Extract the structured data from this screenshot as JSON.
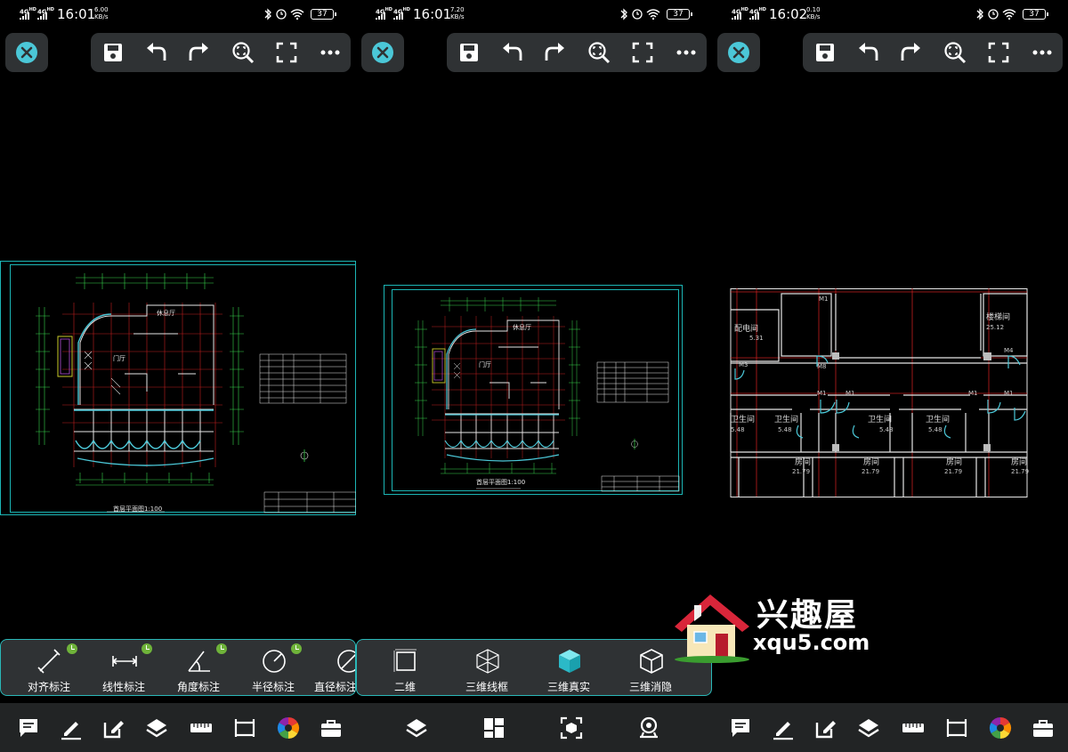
{
  "colors": {
    "accent": "#4bc7d7",
    "panel": "#2f3234",
    "cad_frame": "#1cb6b6",
    "cad_red": "#c21e1e",
    "cad_green": "#38d34c",
    "cad_white": "#e6e6e6",
    "badge_green": "#6fb33a"
  },
  "screens": [
    {
      "status": {
        "sig1": "4G",
        "sig1_sup": "HD",
        "sig2": "4G",
        "sig2_sup": "HD",
        "time": "16:01",
        "speed_value": "6.00",
        "speed_unit": "KB/s",
        "battery": "37"
      },
      "sub_panel": [
        {
          "label": "对齐标注",
          "icon": "aligned-dimension-icon"
        },
        {
          "label": "线性标注",
          "icon": "linear-dimension-icon"
        },
        {
          "label": "角度标注",
          "icon": "angle-dimension-icon"
        },
        {
          "label": "半径标注",
          "icon": "radius-dimension-icon"
        },
        {
          "label": "直径标注",
          "icon": "diameter-dimension-icon"
        }
      ],
      "drawing_title": "首层平面图1:100",
      "room_hall": "门厅",
      "room_lounge": "休息厅"
    },
    {
      "status": {
        "sig1": "4G",
        "sig1_sup": "HD",
        "sig2": "4G",
        "sig2_sup": "HD",
        "time": "16:01",
        "speed_value": "7.20",
        "speed_unit": "KB/s",
        "battery": "37"
      },
      "sub_panel": [
        {
          "label": "二维",
          "icon": "2d-square-icon"
        },
        {
          "label": "三维线框",
          "icon": "3d-wireframe-icon"
        },
        {
          "label": "三维真实",
          "icon": "3d-realistic-icon"
        },
        {
          "label": "三维消隐",
          "icon": "3d-hidden-icon"
        }
      ],
      "drawing_title": "首层平面图1:100",
      "room_hall": "门厅",
      "room_lounge": "休息厅"
    },
    {
      "status": {
        "sig1": "4G",
        "sig1_sup": "HD",
        "sig2": "4G",
        "sig2_sup": "HD",
        "time": "16:02",
        "speed_value": "0.10",
        "speed_unit": "KB/s",
        "battery": "37"
      },
      "rooms": {
        "distribution": "配电间",
        "distribution_area": "5.31",
        "stair": "楼梯间",
        "stair_area": "25.12",
        "toilet": "卫生间",
        "toilet_area": "5.48",
        "room": "房间",
        "room_area": "21.79"
      },
      "doors": {
        "m1": "M1",
        "m3": "M3",
        "m4": "M4",
        "m8": "M8"
      }
    }
  ],
  "watermark": {
    "title": "兴趣屋",
    "url": "xqu5.com"
  }
}
